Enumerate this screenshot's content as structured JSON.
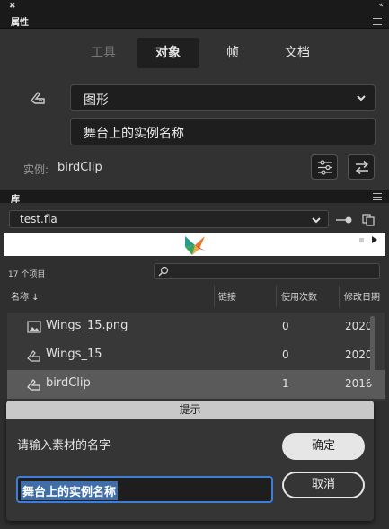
{
  "panel_title": "属性",
  "properties": {
    "tabs": [
      {
        "label": "工具",
        "state": "disabled"
      },
      {
        "label": "对象",
        "state": "active"
      },
      {
        "label": "帧",
        "state": "normal"
      },
      {
        "label": "文档",
        "state": "normal"
      }
    ],
    "symbol_type": "图形",
    "instance_name": "舞台上的实例名称",
    "instance_label": "实例:",
    "instance_value": "birdClip"
  },
  "library": {
    "title": "库",
    "document": "test.fla",
    "item_count": "17 个项目",
    "columns": {
      "name": "名称",
      "linkage": "链接",
      "use_count": "使用次数",
      "modified": "修改日期"
    },
    "items": [
      {
        "icon": "bitmap-icon",
        "name": "Wings_15.png",
        "use_count": "0",
        "modified": "2020",
        "selected": false
      },
      {
        "icon": "graphic-symbol-icon",
        "name": "Wings_15",
        "use_count": "0",
        "modified": "2020",
        "selected": false
      },
      {
        "icon": "graphic-symbol-icon",
        "name": "birdClip",
        "use_count": "1",
        "modified": "2016",
        "selected": true
      }
    ]
  },
  "dialog": {
    "title": "提示",
    "prompt": "请输入素材的名字",
    "input_value": "舞台上的实例名称",
    "ok_label": "确定",
    "cancel_label": "取消"
  },
  "colors": {
    "accent": "#3d7fd8",
    "panel": "#323232",
    "dialog_header": "#c8c8c8"
  }
}
